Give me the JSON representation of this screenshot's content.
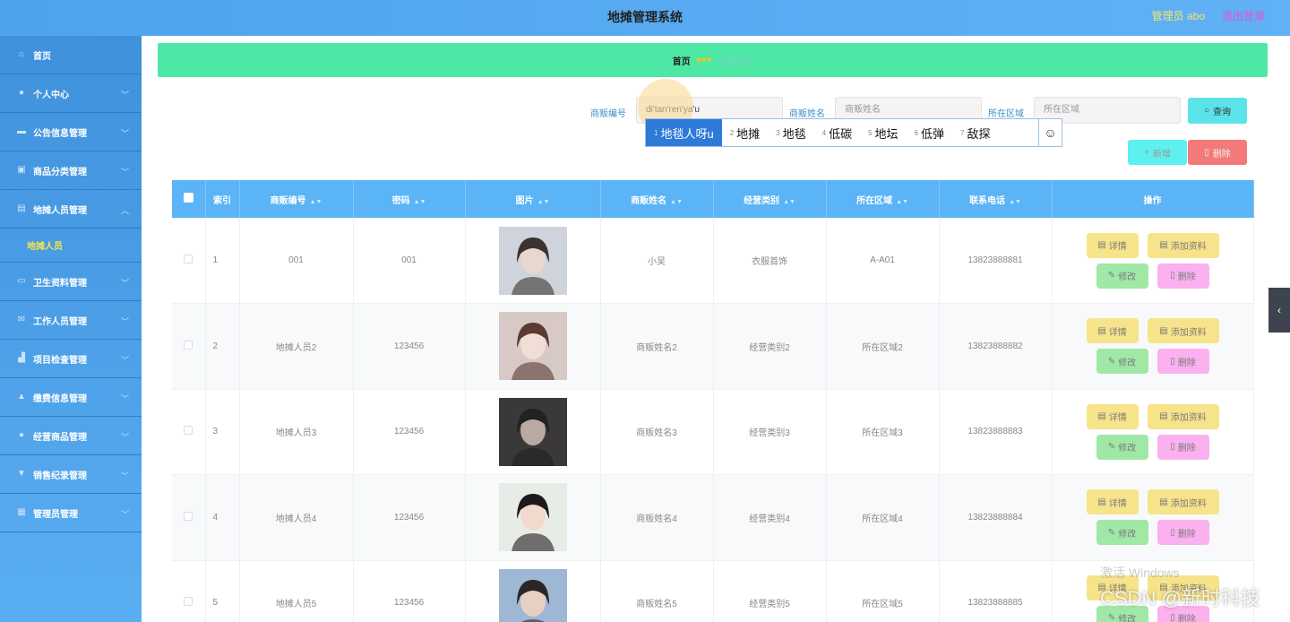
{
  "header": {
    "title": "地摊管理系统",
    "user": "管理员 abo",
    "logout": "退出登录"
  },
  "sidebar": {
    "items": [
      {
        "label": "首页",
        "icon": "home-icon",
        "glyph": "⌂"
      },
      {
        "label": "个人中心",
        "icon": "user-icon",
        "glyph": "●"
      },
      {
        "label": "公告信息管理",
        "icon": "notice-icon",
        "glyph": "▬"
      },
      {
        "label": "商品分类管理",
        "icon": "category-icon",
        "glyph": "▣"
      },
      {
        "label": "地摊人员管理",
        "icon": "document-icon",
        "glyph": "▤",
        "expanded": true,
        "sub": "地摊人员"
      },
      {
        "label": "卫生资料管理",
        "icon": "chat-icon",
        "glyph": "▭"
      },
      {
        "label": "工作人员管理",
        "icon": "mail-icon",
        "glyph": "✉"
      },
      {
        "label": "项目检查管理",
        "icon": "thumb-icon",
        "glyph": "▟"
      },
      {
        "label": "缴费信息管理",
        "icon": "person-icon",
        "glyph": "▲"
      },
      {
        "label": "经营商品管理",
        "icon": "location-icon",
        "glyph": "●"
      },
      {
        "label": "销售纪录管理",
        "icon": "sign-icon",
        "glyph": "▼"
      },
      {
        "label": "管理员管理",
        "icon": "grid-icon",
        "glyph": "▦"
      }
    ]
  },
  "breadcrumb": {
    "home": "首页",
    "separator": "♥♥♥",
    "current": "地摊人员"
  },
  "search": {
    "code_label": "商贩编号",
    "code_value": "di'tan'ren'ya'u",
    "name_label": "商贩姓名",
    "name_placeholder": "商贩姓名",
    "area_label": "所在区域",
    "area_placeholder": "所在区域",
    "query_btn": "查询"
  },
  "actions": {
    "add": "新增",
    "delete": "删除"
  },
  "ime": {
    "candidates": [
      {
        "n": "1",
        "w": "地毯人呀u"
      },
      {
        "n": "2",
        "w": "地摊"
      },
      {
        "n": "3",
        "w": "地毯"
      },
      {
        "n": "4",
        "w": "低碳"
      },
      {
        "n": "5",
        "w": "地坛"
      },
      {
        "n": "6",
        "w": "低弹"
      },
      {
        "n": "7",
        "w": "敌探"
      }
    ]
  },
  "table": {
    "headers": [
      "索引",
      "商贩编号",
      "密码",
      "图片",
      "商贩姓名",
      "经营类别",
      "所在区域",
      "联系电话",
      "操作"
    ],
    "rows": [
      {
        "idx": "1",
        "code": "001",
        "pwd": "001",
        "name": "小吴",
        "cat": "衣服首饰",
        "area": "A-A01",
        "phone": "13823888881",
        "photo": "p1"
      },
      {
        "idx": "2",
        "code": "地摊人员2",
        "pwd": "123456",
        "name": "商贩姓名2",
        "cat": "经营类别2",
        "area": "所在区域2",
        "phone": "13823888882",
        "photo": "p2"
      },
      {
        "idx": "3",
        "code": "地摊人员3",
        "pwd": "123456",
        "name": "商贩姓名3",
        "cat": "经营类别3",
        "area": "所在区域3",
        "phone": "13823888883",
        "photo": "p3"
      },
      {
        "idx": "4",
        "code": "地摊人员4",
        "pwd": "123456",
        "name": "商贩姓名4",
        "cat": "经营类别4",
        "area": "所在区域4",
        "phone": "13823888884",
        "photo": "p4"
      },
      {
        "idx": "5",
        "code": "地摊人员5",
        "pwd": "123456",
        "name": "商贩姓名5",
        "cat": "经营类别5",
        "area": "所在区域5",
        "phone": "13823888885",
        "photo": "p5"
      }
    ],
    "ops": {
      "detail": "详情",
      "add_info": "添加资料",
      "edit": "修改",
      "delete": "删除"
    }
  },
  "watermark": {
    "line1": "激活 Windows",
    "line2": "CSDN @新时科技"
  }
}
